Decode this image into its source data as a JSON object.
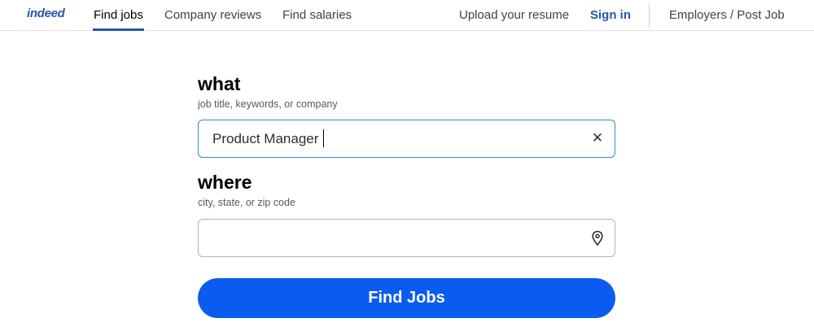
{
  "header": {
    "logo": "indeed",
    "nav": {
      "find_jobs": "Find jobs",
      "company_reviews": "Company reviews",
      "find_salaries": "Find salaries",
      "upload_resume": "Upload your resume",
      "sign_in": "Sign in",
      "employers": "Employers / Post Job"
    }
  },
  "search": {
    "what": {
      "label": "what",
      "hint": "job title, keywords, or company",
      "value": "Product Manager",
      "clear_icon": "close-icon"
    },
    "where": {
      "label": "where",
      "hint": "city, state, or zip code",
      "value": "",
      "location_icon": "map-pin-icon"
    },
    "submit_label": "Find Jobs"
  },
  "colors": {
    "brand": "#2557a7",
    "button": "#0a5bf0",
    "focus_border": "#2a8ecf"
  }
}
